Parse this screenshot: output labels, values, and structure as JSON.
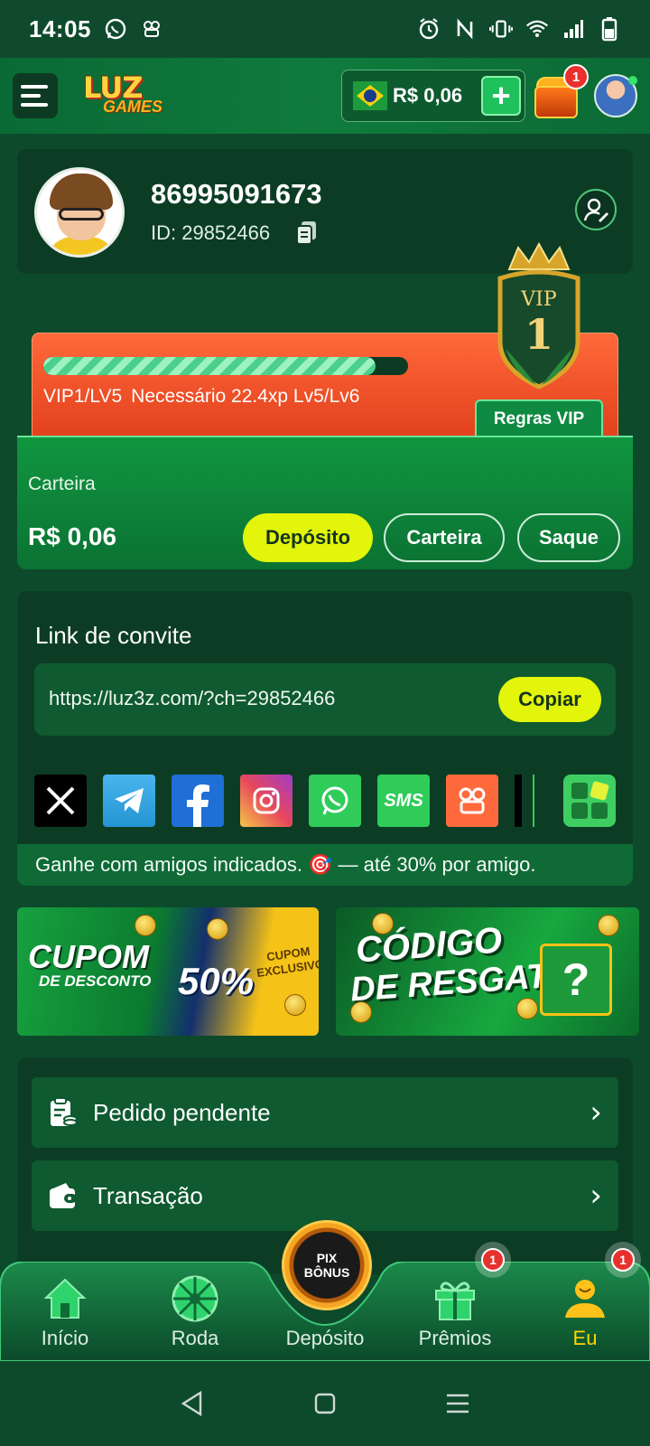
{
  "status_bar": {
    "time": "14:05",
    "left_icons": [
      "whatsapp-icon",
      "kwai-icon"
    ],
    "right_icons": [
      "alarm-icon",
      "nfc-icon",
      "vibrate-icon",
      "wifi-icon",
      "signal-icon",
      "battery-icon"
    ]
  },
  "header": {
    "logo_top": "LUZ",
    "logo_bottom": "GAMES",
    "balance": "R$ 0,06",
    "chest_badge": "1"
  },
  "profile": {
    "name": "86995091673",
    "id_text": "ID: 29852466"
  },
  "vip": {
    "level_label": "VIP",
    "level_number": "1",
    "progress_fraction": 0.91,
    "level_text": "VIP1/LV5",
    "requirement_text": "Necessário 22.4xp Lv5/Lv6",
    "rules_button": "Regras VIP"
  },
  "wallet": {
    "label": "Carteira",
    "amount": "R$ 0,06",
    "deposit_button": "Depósito",
    "wallet_button": "Carteira",
    "withdraw_button": "Saque"
  },
  "invite": {
    "title": "Link de convite",
    "link": "https://luz3z.com/?ch=29852466",
    "copy_button": "Copiar",
    "socials": [
      "X",
      "Telegram",
      "Facebook",
      "Instagram",
      "WhatsApp",
      "SMS",
      "Kwai"
    ],
    "sms_label": "SMS",
    "footer": "Ganhe com amigos indicados. 🎯 — até 30% por amigo."
  },
  "banners": {
    "cupom_line1": "CUPOM",
    "cupom_line2": "DE DESCONTO",
    "cupom_percent": "50%",
    "cupom_exclusive": "CUPOM EXCLUSIVO",
    "codigo_line1": "CÓDIGO",
    "codigo_line2": "DE RESGATE"
  },
  "menu": [
    {
      "label": "Pedido pendente",
      "icon": "pending-order-icon"
    },
    {
      "label": "Transação",
      "icon": "wallet-icon"
    }
  ],
  "bottom_nav": {
    "items": [
      {
        "label": "Início",
        "icon": "home-icon"
      },
      {
        "label": "Roda",
        "icon": "wheel-icon"
      },
      {
        "label": "Depósito",
        "icon": "pix-bonus-icon"
      },
      {
        "label": "Prêmios",
        "icon": "gift-icon"
      },
      {
        "label": "Eu",
        "icon": "user-icon"
      }
    ],
    "center_line1": "PIX",
    "center_line2": "BÔNUS",
    "premios_badge": "1",
    "eu_badge": "1",
    "active": "Eu"
  },
  "colors": {
    "background": "#0d4a2c",
    "accent_yellow": "#e2f50a",
    "vip_orange": "#f0522a",
    "active_nav": "#ffd400"
  }
}
